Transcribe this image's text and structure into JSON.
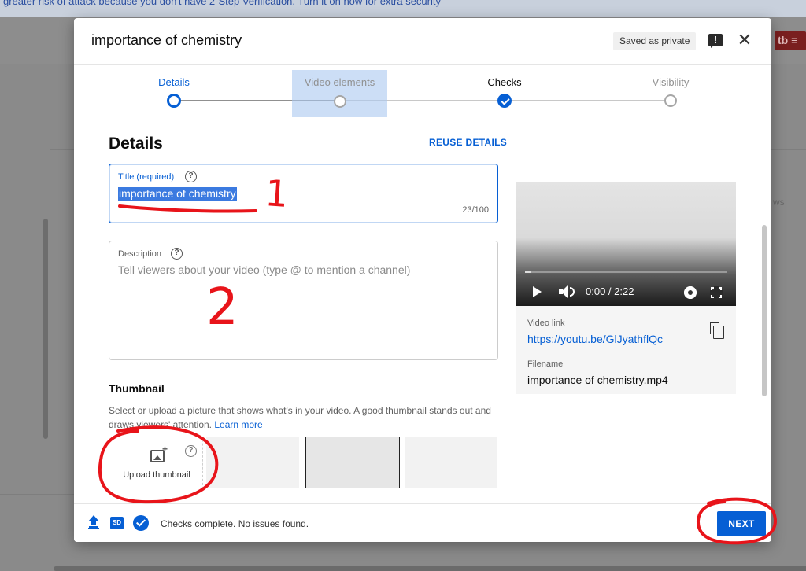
{
  "background": {
    "banner_text": "greater risk of attack because you don't have 2-Step Verification. Turn it on now for extra security",
    "right_badge": "tb ≡",
    "right_text": "ws"
  },
  "dialog": {
    "title": "importance of chemistry",
    "saved_status": "Saved as private",
    "feedback_icon": "!"
  },
  "stepper": {
    "steps": [
      {
        "label": "Details",
        "state": "active"
      },
      {
        "label": "Video elements",
        "state": "highlighted"
      },
      {
        "label": "Checks",
        "state": "done"
      },
      {
        "label": "Visibility",
        "state": "pending"
      }
    ]
  },
  "details": {
    "heading": "Details",
    "reuse_label": "REUSE DETAILS",
    "title_field": {
      "label": "Title (required)",
      "value": "importance of chemistry",
      "char_count": "23/100"
    },
    "description_field": {
      "label": "Description",
      "placeholder": "Tell viewers about your video (type @ to mention a channel)"
    },
    "help_glyph": "?",
    "thumbnail": {
      "heading": "Thumbnail",
      "description": "Select or upload a picture that shows what's in your video. A good thumbnail stands out and draws viewers' attention.",
      "learn_more": "Learn more",
      "upload_label": "Upload thumbnail",
      "upload_plus": "+"
    }
  },
  "video_card": {
    "time": "0:00 / 2:22",
    "video_link_label": "Video link",
    "video_link": "https://youtu.be/GlJyathflQc",
    "filename_label": "Filename",
    "filename": "importance of chemistry.mp4"
  },
  "footer": {
    "sd_label": "SD",
    "status": "Checks complete. No issues found.",
    "next_label": "NEXT"
  },
  "annotations": {
    "number_1": "1",
    "number_2": "2",
    "color": "#e8141a"
  },
  "colors": {
    "accent": "#065fd4",
    "annotation": "#e8141a"
  }
}
